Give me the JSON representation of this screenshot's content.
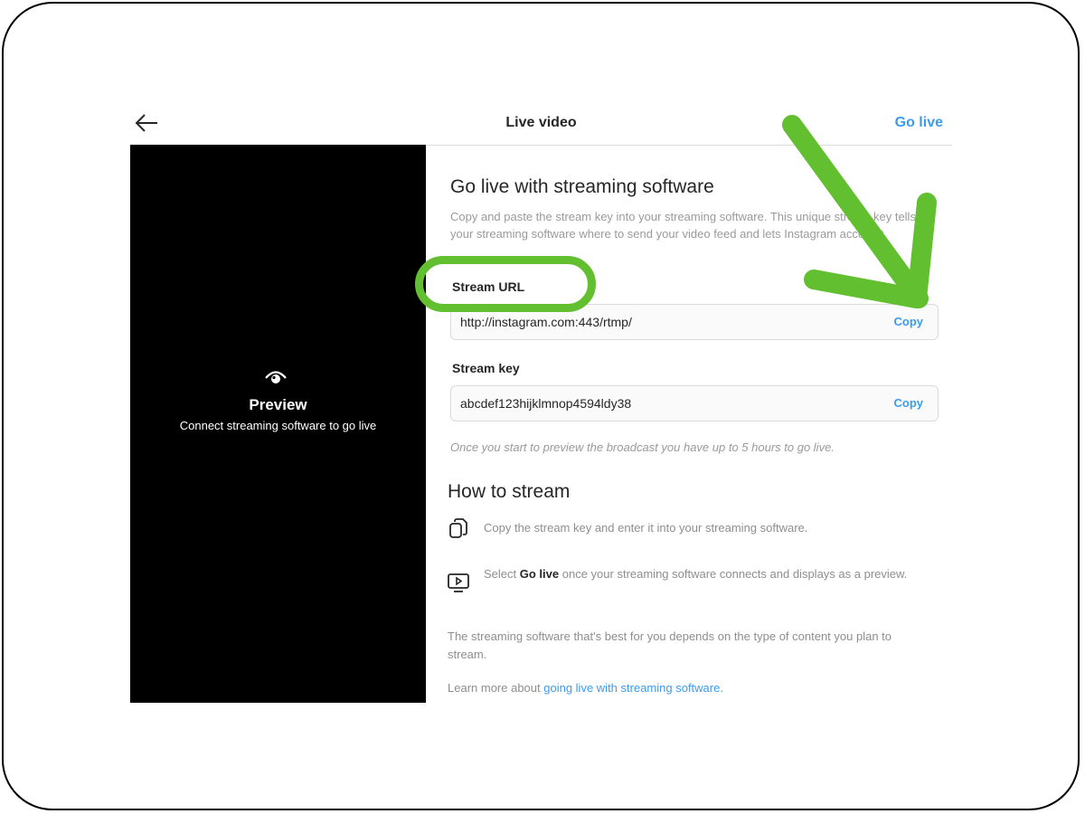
{
  "header": {
    "title": "Live video",
    "go_live": "Go live"
  },
  "preview": {
    "title": "Preview",
    "subtitle": "Connect streaming software to go live"
  },
  "main": {
    "title": "Go live with streaming software",
    "description": "Copy and paste the stream key into your streaming software. This unique stream key tells your streaming software where to send your video feed and lets Instagram accept it.",
    "stream_url": {
      "label": "Stream URL",
      "value": "http://instagram.com:443/rtmp/",
      "copy": "Copy"
    },
    "stream_key": {
      "label": "Stream key",
      "value": "abcdef123hijklmnop4594ldy38",
      "copy": "Copy"
    },
    "note": "Once you start to preview the broadcast you have up to 5 hours to go live."
  },
  "how_to": {
    "title": "How to stream",
    "step1": "Copy the stream key and enter it into your streaming software.",
    "step2_prefix": "Select",
    "step2_bold": "Go live",
    "step2_suffix": "once your streaming software connects and displays as a preview.",
    "para1": "The streaming software that's best for you depends on the type of content you plan to stream.",
    "learn_prefix": "Learn more about",
    "learn_link": "going live with streaming software."
  },
  "icons": {
    "back": "arrow-left-icon",
    "preview": "eye-icon",
    "step1": "copy-icon",
    "step2": "monitor-play-icon"
  },
  "colors": {
    "accent": "#3d9bef",
    "annotation": "#62bf2f"
  }
}
